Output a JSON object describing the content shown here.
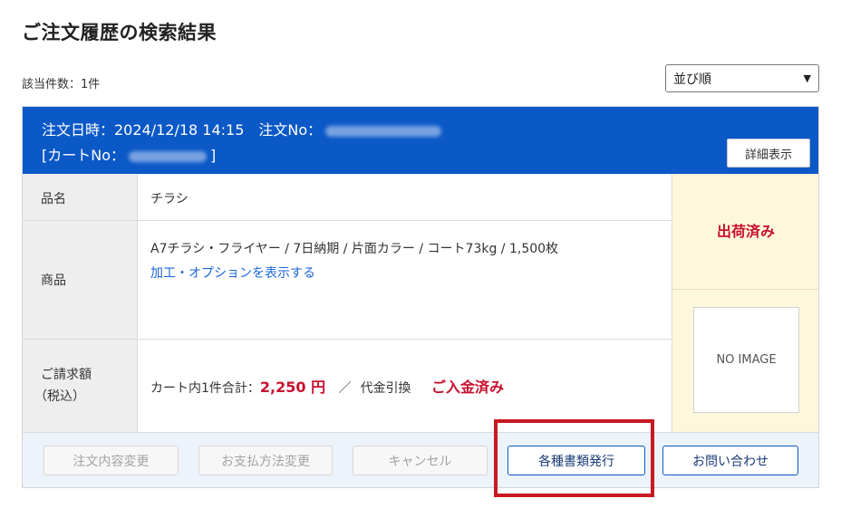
{
  "page": {
    "title": "ご注文履歴の検索結果"
  },
  "results": {
    "count_label": "該当件数：1件"
  },
  "sort": {
    "selected": "並び順"
  },
  "order": {
    "header_line1": "注文日時：2024/12/18 14:15　注文No：",
    "header_line2_prefix": "[カートNo：",
    "header_line2_suffix": "]",
    "detail_button": "詳細表示",
    "item_name_label": "品名",
    "item_name": "チラシ",
    "product_label": "商品",
    "product_spec": "A7チラシ・フライヤー / 7日納期 / 片面カラー / コート73kg / 1,500枚",
    "options_link": "加工・オプションを表示する",
    "billing_label_line1": "ご請求額",
    "billing_label_line2": "（税込）",
    "billing_prefix": "カート内1件合計：",
    "billing_amount": "2,250 円",
    "billing_separator": "／",
    "payment_method": "代金引換",
    "payment_status": "ご入金済み",
    "shipping_status": "出荷済み",
    "no_image": "NO IMAGE"
  },
  "actions": {
    "change_order": "注文内容変更",
    "change_payment": "お支払方法変更",
    "cancel": "キャンセル",
    "issue_documents": "各種書類発行",
    "contact": "お問い合わせ"
  },
  "colors": {
    "header_bg": "#0b58c7",
    "accent_red": "#c8102e",
    "status_panel_bg": "#fdf8dc",
    "action_bar_bg": "#edf3fb",
    "link_blue": "#1a66d9"
  }
}
